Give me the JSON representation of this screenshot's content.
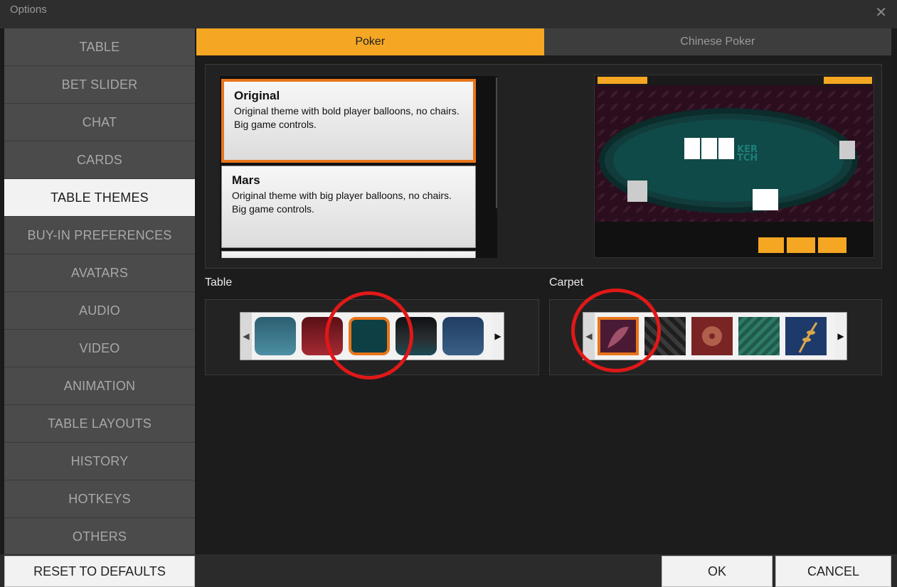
{
  "window": {
    "title": "Options",
    "close_glyph": "✕"
  },
  "sidebar": {
    "items": [
      {
        "label": "TABLE"
      },
      {
        "label": "BET SLIDER"
      },
      {
        "label": "CHAT"
      },
      {
        "label": "CARDS"
      },
      {
        "label": "TABLE THEMES",
        "active": true
      },
      {
        "label": "BUY-IN PREFERENCES"
      },
      {
        "label": "AVATARS"
      },
      {
        "label": "AUDIO"
      },
      {
        "label": "VIDEO"
      },
      {
        "label": "ANIMATION"
      },
      {
        "label": "TABLE LAYOUTS"
      },
      {
        "label": "HISTORY"
      },
      {
        "label": "HOTKEYS"
      },
      {
        "label": "OTHERS"
      }
    ],
    "reset_label": "RESET TO DEFAULTS"
  },
  "tabs": [
    {
      "label": "Poker",
      "active": true
    },
    {
      "label": "Chinese Poker",
      "active": false
    }
  ],
  "themes": [
    {
      "name": "Original",
      "description": "Original theme with bold player balloons, no chairs. Big game controls.",
      "selected": true
    },
    {
      "name": "Mars",
      "description": "Original theme with big player balloons, no chairs. Big game controls.",
      "selected": false
    }
  ],
  "table_section": {
    "label": "Table",
    "swatches": [
      "#3c7386",
      "#7d1a22",
      "#0e3f44",
      "#1c1f22",
      "#2a4a6e"
    ],
    "selected_index": 2
  },
  "carpet_section": {
    "label": "Carpet",
    "carpets": [
      "#4a1a35",
      "#2a2a2a",
      "#7a2424",
      "#1f5a4a",
      "#1e3a6b"
    ],
    "selected_index": 0
  },
  "footer": {
    "ok_label": "OK",
    "cancel_label": "CANCEL"
  },
  "colors": {
    "accent": "#f5a623",
    "selection": "#e8751a",
    "annotation": "#e01818"
  }
}
